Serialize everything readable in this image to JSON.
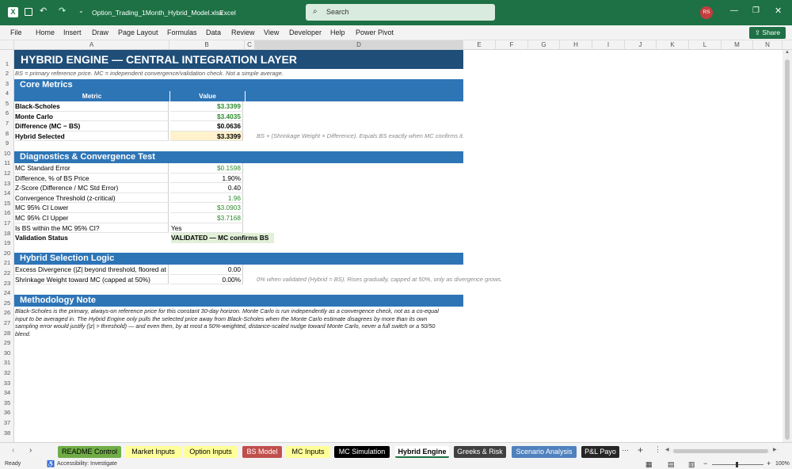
{
  "titlebar": {
    "filename": "Option_Trading_1Month_Hybrid_Model.xlsx",
    "app": "Excel",
    "search_placeholder": "Search",
    "user_initials": "RS"
  },
  "ribbon": {
    "tabs": [
      "File",
      "Home",
      "Insert",
      "Draw",
      "Page Layout",
      "Formulas",
      "Data",
      "Review",
      "View",
      "Developer",
      "Help",
      "Power Pivot"
    ],
    "share_label": "Share"
  },
  "columns": [
    "A",
    "B",
    "C",
    "D",
    "E",
    "F",
    "G",
    "H",
    "I",
    "J",
    "K",
    "L",
    "M",
    "N"
  ],
  "rows": [
    "1",
    "2",
    "3",
    "4",
    "5",
    "6",
    "7",
    "8",
    "9",
    "10",
    "11",
    "12",
    "13",
    "14",
    "15",
    "16",
    "17",
    "18",
    "19",
    "20",
    "21",
    "22",
    "23",
    "24",
    "25",
    "26",
    "27",
    "28",
    "29",
    "30",
    "31",
    "32",
    "33",
    "34",
    "35",
    "36",
    "37",
    "38"
  ],
  "sheet": {
    "title": "HYBRID ENGINE — CENTRAL INTEGRATION LAYER",
    "subtitle": "BS = primary reference price. MC = independent convergence/validation check. Not a simple average.",
    "core": {
      "header": "Core Metrics",
      "col_metric": "Metric",
      "col_value": "Value",
      "rows": [
        {
          "label": "Black-Scholes",
          "value": "$3.3399",
          "color": "#2e8b2e",
          "bold": true
        },
        {
          "label": "Monte Carlo",
          "value": "$3.4035",
          "color": "#2e8b2e",
          "bold": true
        },
        {
          "label": "Difference  (MC − BS)",
          "value": "$0.0636",
          "color": "#000000",
          "bold": true
        },
        {
          "label": "Hybrid Selected",
          "value": "$3.3399",
          "color": "#000000",
          "bold": true
        }
      ],
      "hybrid_note": "BS + (Shrinkage Weight × Difference). Equals BS exactly when MC confirms it."
    },
    "diagnostics": {
      "header": "Diagnostics & Convergence Test",
      "rows": [
        {
          "label": "MC Standard Error",
          "value": "$0.1598",
          "color": "#2e8b2e"
        },
        {
          "label": "Difference, % of BS Price",
          "value": "1.90%",
          "color": "#000000"
        },
        {
          "label": "Z-Score  (Difference / MC Std Error)",
          "value": "0.40",
          "color": "#000000"
        },
        {
          "label": "Convergence Threshold (z-critical)",
          "value": "1.96",
          "color": "#2e8b2e"
        },
        {
          "label": "MC 95% CI Lower",
          "value": "$3.0903",
          "color": "#2e8b2e"
        },
        {
          "label": "MC 95% CI Upper",
          "value": "$3.7168",
          "color": "#2e8b2e"
        },
        {
          "label": "Is BS within the MC 95% CI?",
          "value": "Yes",
          "color": "#000000"
        }
      ],
      "status_label": "Validation Status",
      "status_value": "VALIDATED — MC confirms BS"
    },
    "selection": {
      "header": "Hybrid Selection Logic",
      "rows": [
        {
          "label": "Excess Divergence  (|Z| beyond threshold, floored at 0)",
          "value": "0.00"
        },
        {
          "label": "Shrinkage Weight toward MC (capped at 50%)",
          "value": "0.00%"
        }
      ],
      "weight_note": "0% when validated (Hybrid = BS). Rises gradually, capped at 50%, only as divergence grows."
    },
    "methodology": {
      "header": "Methodology Note",
      "lines": [
        "Black-Scholes is the primary, always-on reference price for this constant 30-day horizon. Monte Carlo is run independently as a convergence check, not as a co-equal",
        "input to be averaged in. The Hybrid Engine only pulls the selected price away from Black-Scholes when the Monte Carlo estimate disagrees by more than its own",
        "sampling error would justify (|z| > threshold) — and even then, by at most a 50%-weighted, distance-scaled nudge toward Monte Carlo, never a full switch or a 50/50",
        "blend."
      ]
    }
  },
  "sheet_tabs": [
    {
      "label": "README Control",
      "bg": "#70ad47",
      "fg": "#000000"
    },
    {
      "label": "Market Inputs",
      "bg": "#ffff99",
      "fg": "#000000"
    },
    {
      "label": "Option Inputs",
      "bg": "#ffff99",
      "fg": "#000000"
    },
    {
      "label": "BS Model",
      "bg": "#c0504d",
      "fg": "#ffffff"
    },
    {
      "label": "MC Inputs",
      "bg": "#ffff99",
      "fg": "#000000"
    },
    {
      "label": "MC Simulation",
      "bg": "#000000",
      "fg": "#ffffff"
    },
    {
      "label": "Hybrid Engine",
      "bg": "#ffffff",
      "fg": "#000000"
    },
    {
      "label": "Greeks & Risk",
      "bg": "#404040",
      "fg": "#ffffff"
    },
    {
      "label": "Scenario Analysis",
      "bg": "#4f81bd",
      "fg": "#ffffff"
    },
    {
      "label": "P&L Payo",
      "bg": "#262626",
      "fg": "#ffffff"
    }
  ],
  "status": {
    "ready": "Ready",
    "accessibility": "Accessibility: Investigate",
    "zoom": "100%"
  },
  "colors": {
    "excel_green": "#1e7145",
    "banner_blue": "#2e75b6",
    "title_navy": "#1f4e79",
    "hybrid_fill": "#fff2cc"
  }
}
